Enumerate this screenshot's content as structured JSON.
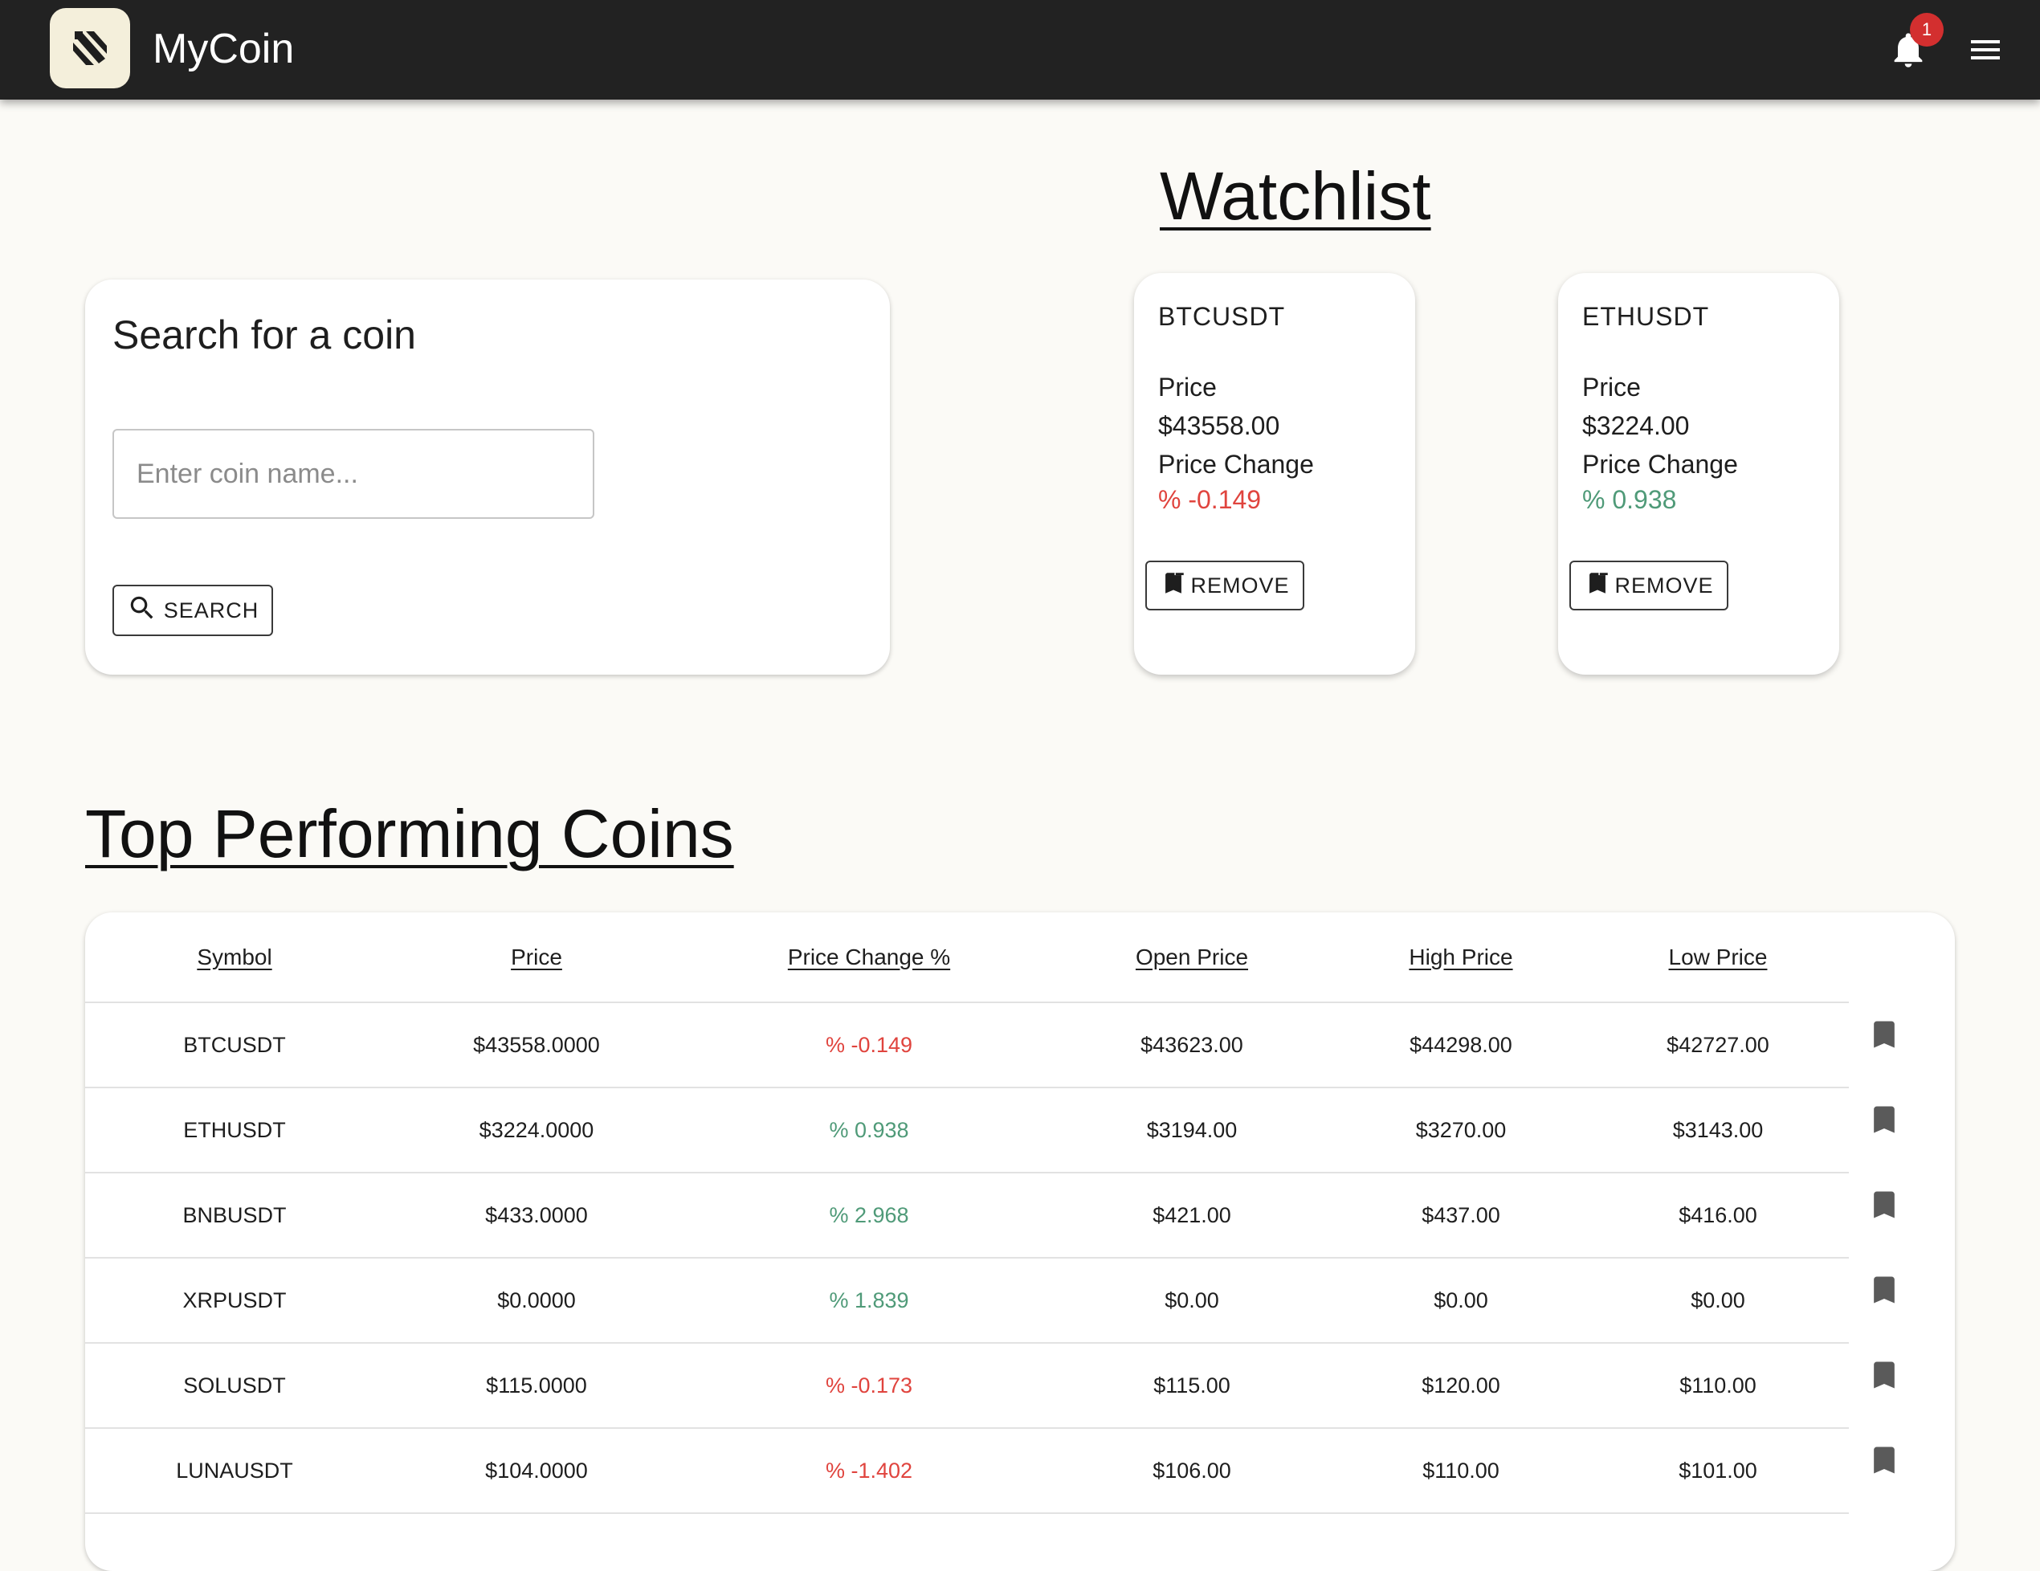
{
  "app": {
    "title": "MyCoin",
    "notification_count": "1"
  },
  "watchlist": {
    "heading": "Watchlist",
    "price_label": "Price",
    "change_label": "Price Change",
    "remove_label": "REMOVE",
    "items": [
      {
        "symbol": "BTCUSDT",
        "price": "$43558.00",
        "change": "% -0.149",
        "trend": "negative"
      },
      {
        "symbol": "ETHUSDT",
        "price": "$3224.00",
        "change": "% 0.938",
        "trend": "positive"
      }
    ]
  },
  "search": {
    "title": "Search for a coin",
    "placeholder": "Enter coin name...",
    "button_label": "SEARCH"
  },
  "top_coins": {
    "heading": "Top Performing Coins",
    "columns": [
      "Symbol",
      "Price",
      "Price Change %",
      "Open Price",
      "High Price",
      "Low Price"
    ],
    "rows": [
      {
        "symbol": "BTCUSDT",
        "price": "$43558.0000",
        "change": "% -0.149",
        "trend": "negative",
        "open": "$43623.00",
        "high": "$44298.00",
        "low": "$42727.00"
      },
      {
        "symbol": "ETHUSDT",
        "price": "$3224.0000",
        "change": "% 0.938",
        "trend": "positive",
        "open": "$3194.00",
        "high": "$3270.00",
        "low": "$3143.00"
      },
      {
        "symbol": "BNBUSDT",
        "price": "$433.0000",
        "change": "% 2.968",
        "trend": "positive",
        "open": "$421.00",
        "high": "$437.00",
        "low": "$416.00"
      },
      {
        "symbol": "XRPUSDT",
        "price": "$0.0000",
        "change": "% 1.839",
        "trend": "positive",
        "open": "$0.00",
        "high": "$0.00",
        "low": "$0.00"
      },
      {
        "symbol": "SOLUSDT",
        "price": "$115.0000",
        "change": "% -0.173",
        "trend": "negative",
        "open": "$115.00",
        "high": "$120.00",
        "low": "$110.00"
      },
      {
        "symbol": "LUNAUSDT",
        "price": "$104.0000",
        "change": "% -1.402",
        "trend": "negative",
        "open": "$106.00",
        "high": "$110.00",
        "low": "$101.00"
      }
    ]
  },
  "colors": {
    "appbar": "#222222",
    "background": "#fbfaf6",
    "negative": "#e0443e",
    "positive": "#4f9a78",
    "badge": "#d32f2f"
  },
  "icons": {
    "logo": "brand-logo-icon",
    "notifications": "bell-icon",
    "menu": "hamburger-menu-icon",
    "search": "search-icon",
    "remove": "bookmark-remove-icon",
    "row_action": "bookmark-icon"
  }
}
